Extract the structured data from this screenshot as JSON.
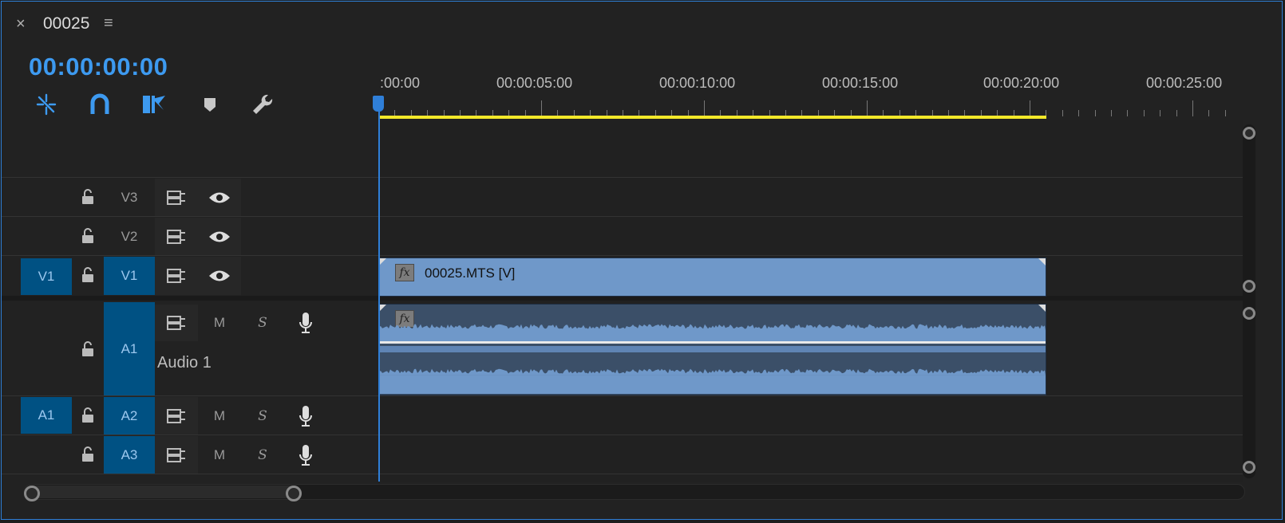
{
  "tab": {
    "close_icon": "×",
    "title": "00025",
    "menu_icon": "≡"
  },
  "timecode": "00:00:00:00",
  "toolbar": [
    "insert-overwrite-sequences-icon",
    "snap-magnet-icon",
    "linked-selection-icon",
    "add-marker-icon",
    "timeline-settings-wrench-icon"
  ],
  "ruler": {
    "labels": [
      ":00:00",
      "00:00:05:00",
      "00:00:10:00",
      "00:00:15:00",
      "00:00:20:00",
      "00:00:25:00"
    ]
  },
  "tracks": {
    "v3": {
      "name": "V3"
    },
    "v2": {
      "name": "V2"
    },
    "v1": {
      "source": "V1",
      "name": "V1"
    },
    "a1": {
      "name": "A1",
      "label": "Audio 1",
      "mute": "M",
      "solo": "S"
    },
    "a2": {
      "source": "A1",
      "name": "A2",
      "mute": "M",
      "solo": "S"
    },
    "a3": {
      "name": "A3",
      "mute": "M",
      "solo": "S"
    }
  },
  "clips": {
    "video": {
      "name": "00025.MTS [V]",
      "fx": "fx"
    },
    "audio": {
      "fx": "fx"
    }
  },
  "colors": {
    "accent": "#2f7fd8",
    "timecode": "#3d9af0",
    "target": "#005183",
    "video_clip": "#6f98c9",
    "audio_clip": "#3b4f68",
    "work_area": "#f2e82a"
  }
}
